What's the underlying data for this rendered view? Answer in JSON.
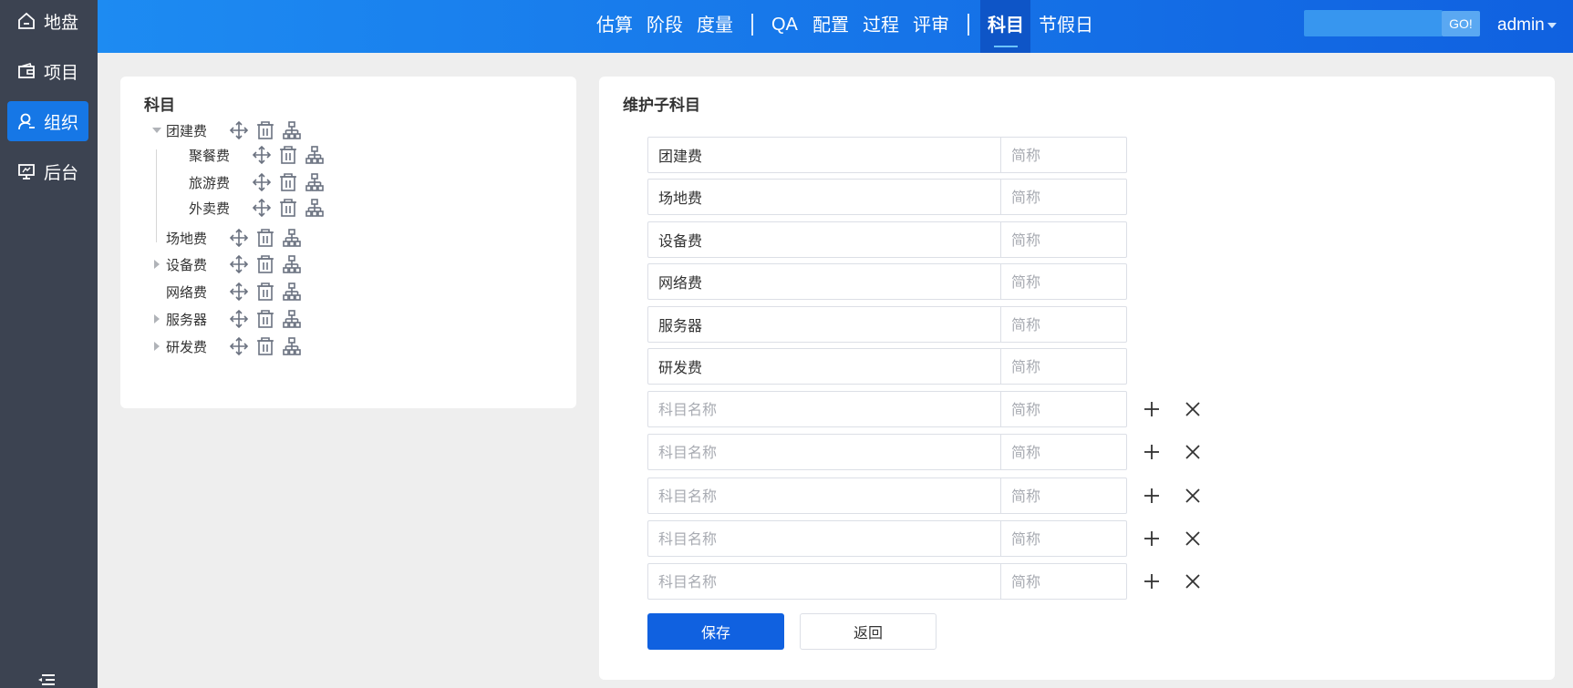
{
  "sidebar": {
    "items": [
      {
        "label": "地盘",
        "icon": "home-icon",
        "active": false
      },
      {
        "label": "项目",
        "icon": "wallet-icon",
        "active": false
      },
      {
        "label": "组织",
        "icon": "user-icon",
        "active": true
      },
      {
        "label": "后台",
        "icon": "monitor-icon",
        "active": false
      }
    ],
    "collapse_icon": "collapse-menu-icon"
  },
  "topnav": {
    "items": [
      "估算",
      "阶段",
      "度量",
      "QA",
      "配置",
      "过程",
      "评审",
      "科目",
      "节假日"
    ],
    "active": "科目",
    "search_placeholder": "",
    "go_label": "GO!",
    "user": "admin"
  },
  "tree_panel": {
    "title": "科目",
    "nodes": [
      {
        "label": "团建费",
        "expanded": true
      },
      {
        "label": "聚餐费"
      },
      {
        "label": "旅游费"
      },
      {
        "label": "外卖费"
      },
      {
        "label": "场地费"
      },
      {
        "label": "设备费",
        "collapsed": true
      },
      {
        "label": "网络费"
      },
      {
        "label": "服务器",
        "collapsed": true
      },
      {
        "label": "研发费",
        "collapsed": true
      }
    ],
    "action_icons": [
      "move-icon",
      "delete-icon",
      "hierarchy-icon"
    ]
  },
  "form_panel": {
    "title": "维护子科目",
    "rows": [
      {
        "name": "团建费",
        "abbr": ""
      },
      {
        "name": "场地费",
        "abbr": ""
      },
      {
        "name": "设备费",
        "abbr": ""
      },
      {
        "name": "网络费",
        "abbr": ""
      },
      {
        "name": "服务器",
        "abbr": ""
      },
      {
        "name": "研发费",
        "abbr": ""
      },
      {
        "name": "",
        "abbr": ""
      },
      {
        "name": "",
        "abbr": ""
      },
      {
        "name": "",
        "abbr": ""
      },
      {
        "name": "",
        "abbr": ""
      },
      {
        "name": "",
        "abbr": ""
      }
    ],
    "name_placeholder": "科目名称",
    "abbr_placeholder": "简称",
    "save_label": "保存",
    "back_label": "返回"
  },
  "colors": {
    "sidebar_bg": "#3c4351",
    "active_blue": "#1677e6",
    "topbar_start": "#1d8bf2",
    "topbar_end": "#1061e0",
    "primary_button": "#1061e0"
  }
}
